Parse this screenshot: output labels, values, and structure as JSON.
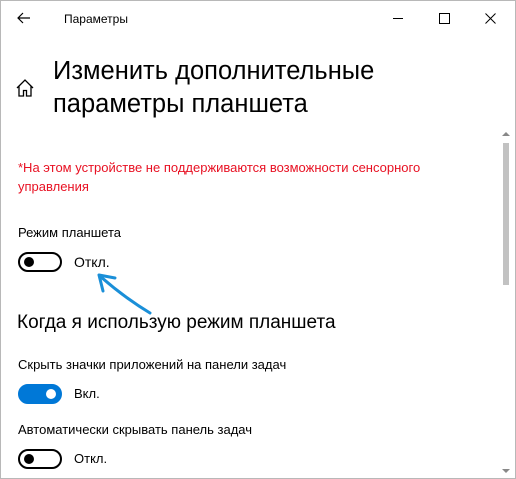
{
  "window": {
    "title": "Параметры"
  },
  "page": {
    "title": "Изменить дополнительные параметры планшета",
    "warning": "*На этом устройстве не поддерживаются возможности сенсорного управления"
  },
  "settings": [
    {
      "label": "Режим планшета",
      "state": "Откл.",
      "on": false
    },
    {
      "label": "Скрыть значки приложений на панели задач",
      "state": "Вкл.",
      "on": true
    },
    {
      "label": "Автоматически скрывать панель задач",
      "state": "Откл.",
      "on": false
    }
  ],
  "section": {
    "title": "Когда я использую режим планшета"
  },
  "icons": {
    "back": "back-arrow-icon",
    "minimize": "minimize-icon",
    "maximize": "maximize-icon",
    "close": "close-icon",
    "home": "home-icon"
  },
  "colors": {
    "accent": "#0078d7",
    "warning": "#e81123",
    "annotation_arrow": "#1a8fd8"
  }
}
